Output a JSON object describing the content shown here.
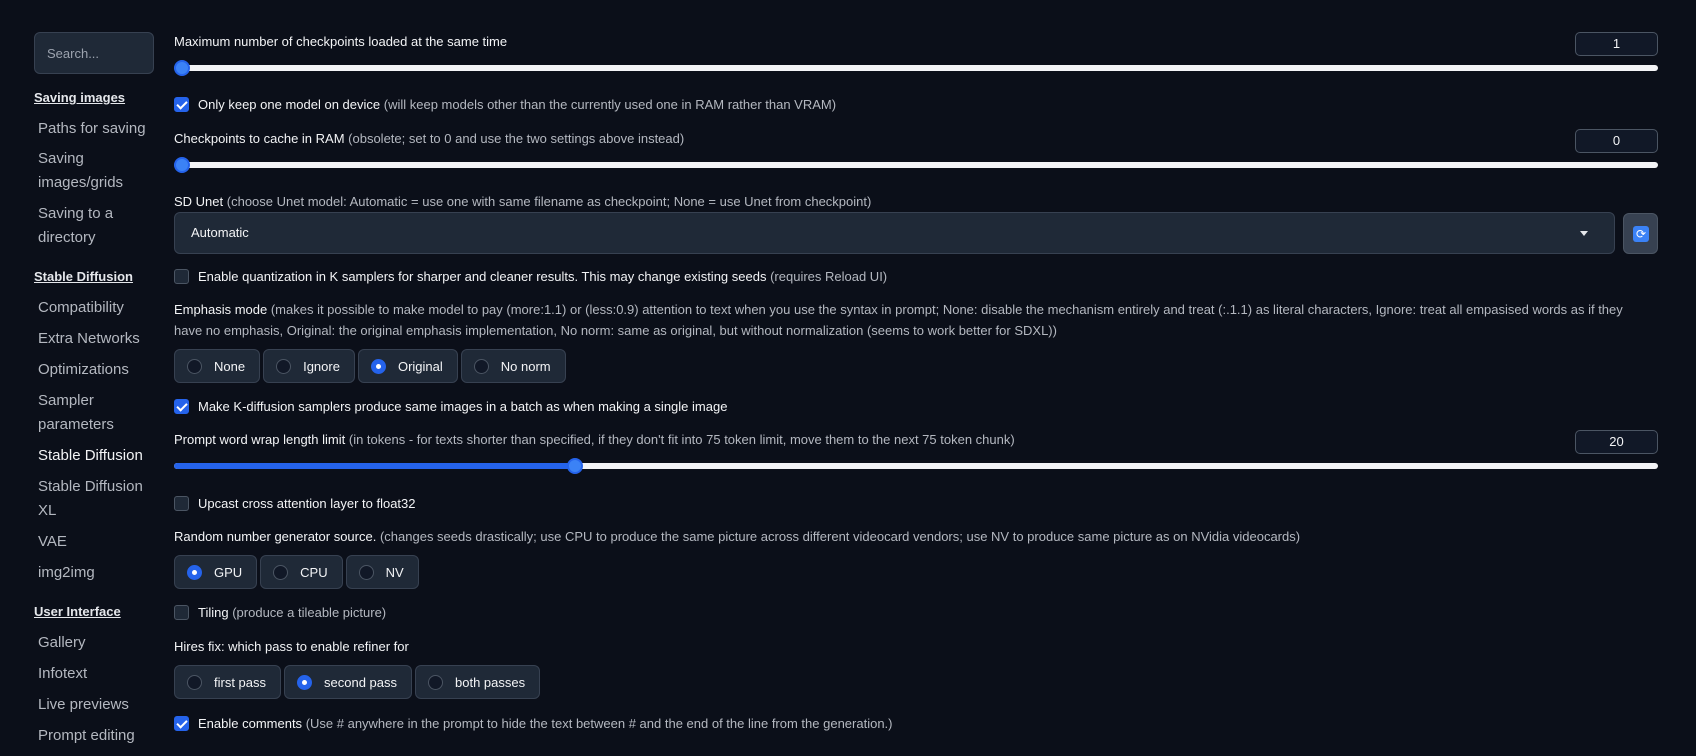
{
  "sidebar": {
    "search_placeholder": "Search...",
    "sections": [
      {
        "title": "Saving images",
        "items": [
          "Paths for saving",
          "Saving images/grids",
          "Saving to a directory"
        ]
      },
      {
        "title": "Stable Diffusion",
        "items": [
          "Compatibility",
          "Extra Networks",
          "Optimizations",
          "Sampler parameters",
          "Stable Diffusion",
          "Stable Diffusion XL",
          "VAE",
          "img2img"
        ]
      },
      {
        "title": "User Interface",
        "items": [
          "Gallery",
          "Infotext",
          "Live previews",
          "Prompt editing"
        ]
      }
    ],
    "active_item": "Stable Diffusion"
  },
  "settings": {
    "max_checkpoints": {
      "label": "Maximum number of checkpoints loaded at the same time",
      "value": "1",
      "slider_fraction": 0.0
    },
    "keep_one_model": {
      "label": "Only keep one model on device",
      "hint": "(will keep models other than the currently used one in RAM rather than VRAM)",
      "checked": true
    },
    "checkpoints_cache": {
      "label": "Checkpoints to cache in RAM",
      "hint": "(obsolete; set to 0 and use the two settings above instead)",
      "value": "0",
      "slider_fraction": 0.0
    },
    "sd_unet": {
      "label": "SD Unet",
      "hint": "(choose Unet model: Automatic = use one with same filename as checkpoint; None = use Unet from checkpoint)",
      "value": "Automatic"
    },
    "quantization": {
      "label": "Enable quantization in K samplers for sharper and cleaner results. This may change existing seeds",
      "hint": "(requires Reload UI)",
      "checked": false
    },
    "emphasis": {
      "label": "Emphasis mode",
      "hint_line1": "(makes it possible to make model to pay (more:1.1) or (less:0.9) attention to text when you use the syntax in prompt; None: disable the mechanism entirely and treat (:.1.1) as literal characters, Ignore: treat all empasised words as if they",
      "hint_line2": "have no emphasis, Original: the original emphasis implementation, No norm: same as original, but without normalization (seems to work better for SDXL))",
      "options": [
        "None",
        "Ignore",
        "Original",
        "No norm"
      ],
      "selected": "Original"
    },
    "kdiffusion_batch": {
      "label": "Make K-diffusion samplers produce same images in a batch as when making a single image",
      "checked": true
    },
    "word_wrap": {
      "label": "Prompt word wrap length limit",
      "hint": "(in tokens - for texts shorter than specified, if they don't fit into 75 token limit, move them to the next 75 token chunk)",
      "value": "20",
      "slider_fraction": 0.27
    },
    "upcast": {
      "label": "Upcast cross attention layer to float32",
      "checked": false
    },
    "rng": {
      "label": "Random number generator source.",
      "hint": "(changes seeds drastically; use CPU to produce the same picture across different videocard vendors; use NV to produce same picture as on NVidia videocards)",
      "options": [
        "GPU",
        "CPU",
        "NV"
      ],
      "selected": "GPU"
    },
    "tiling": {
      "label": "Tiling",
      "hint": "(produce a tileable picture)",
      "checked": false
    },
    "hires_refiner": {
      "label": "Hires fix: which pass to enable refiner for",
      "options": [
        "first pass",
        "second pass",
        "both passes"
      ],
      "selected": "second pass"
    },
    "comments": {
      "label": "Enable comments",
      "hint": "(Use # anywhere in the prompt to hide the text between # and the end of the line from the generation.)",
      "checked": true
    }
  },
  "colors": {
    "background": "#0b0f19",
    "accent": "#2563eb",
    "panel": "#1f2937"
  },
  "icons": {
    "refresh": "refresh-icon",
    "dropdown": "chevron-down-icon"
  }
}
